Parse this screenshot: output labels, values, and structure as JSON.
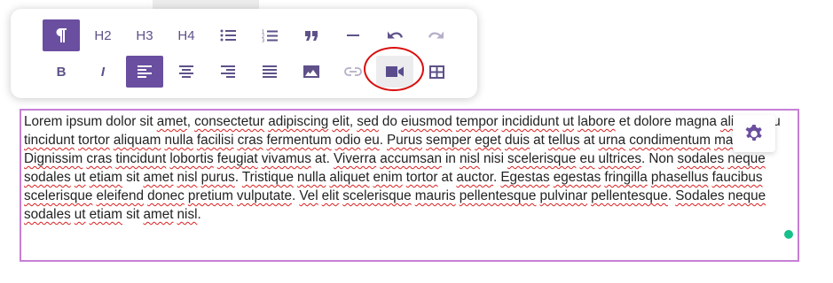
{
  "toolbar": {
    "row1": [
      {
        "name": "paragraph-button",
        "icon": "paragraph-icon",
        "active": true
      },
      {
        "name": "heading2-button",
        "label": "H2"
      },
      {
        "name": "heading3-button",
        "label": "H3"
      },
      {
        "name": "heading4-button",
        "label": "H4"
      },
      {
        "name": "bullet-list-button",
        "icon": "bullet-list-icon"
      },
      {
        "name": "ordered-list-button",
        "icon": "ordered-list-icon"
      },
      {
        "name": "quote-button",
        "icon": "quote-icon"
      },
      {
        "name": "horizontal-rule-button",
        "icon": "horizontal-rule-icon"
      },
      {
        "name": "undo-button",
        "icon": "undo-icon"
      },
      {
        "name": "redo-button",
        "icon": "redo-icon",
        "disabled": true
      }
    ],
    "row2": [
      {
        "name": "bold-button",
        "label": "B"
      },
      {
        "name": "italic-button",
        "label": "I"
      },
      {
        "name": "align-left-button",
        "icon": "align-left-icon",
        "active": true
      },
      {
        "name": "align-center-button",
        "icon": "align-center-icon"
      },
      {
        "name": "align-right-button",
        "icon": "align-right-icon"
      },
      {
        "name": "align-justify-button",
        "icon": "align-justify-icon"
      },
      {
        "name": "image-button",
        "icon": "image-icon"
      },
      {
        "name": "link-button",
        "icon": "link-icon",
        "disabled": true
      },
      {
        "name": "video-button",
        "icon": "video-icon",
        "highlighted": true
      },
      {
        "name": "table-button",
        "icon": "table-icon"
      }
    ]
  },
  "editor": {
    "paragraph": "Lorem ipsum dolor sit amet, consectetur adipiscing elit, sed do eiusmod tempor incididunt ut labore et dolore magna aliqua. Eu tincidunt tortor aliquam nulla facilisi cras fermentum odio eu. Purus semper eget duis at tellus at urna condimentum mattis. Dignissim cras tincidunt lobortis feugiat vivamus at. Viverra accumsan in nisl nisi scelerisque eu ultrices. Non sodales neque sodales ut etiam sit amet nisl purus. Tristique nulla aliquet enim tortor at auctor. Egestas egestas fringilla phasellus faucibus scelerisque eleifend donec pretium vulputate. Vel elit scelerisque mauris pellentesque pulvinar pellentesque. Sodales neque sodales ut etiam sit amet nisl.",
    "misspelled": [
      "amet",
      "consectetur",
      "adipiscing",
      "elit",
      "sed",
      "eiusmod",
      "tempor",
      "incididunt",
      "labore",
      "aliqua",
      "tincidunt",
      "tortor",
      "aliquam",
      "nulla",
      "facilisi",
      "cras",
      "fermentum",
      "odio",
      "eu",
      "Purus",
      "semper",
      "eget",
      "duis",
      "tellus",
      "urna",
      "condimentum",
      "mattis",
      "Dignissim",
      "lobortis",
      "feugiat",
      "vivamus",
      "Viverra",
      "accumsan",
      "nisl",
      "ultrices",
      "sodales",
      "neque",
      "ut",
      "etiam",
      "purus",
      "Tristique",
      "aliquet",
      "enim",
      "auctor",
      "Egestas",
      "egestas",
      "fringilla",
      "phasellus",
      "faucibus",
      "scelerisque",
      "eleifend",
      "donec",
      "pretium",
      "vulputate",
      "Vel",
      "mauris",
      "pellentesque",
      "pulvinar",
      "Sodales"
    ]
  },
  "colors": {
    "accent": "#6a4fa0",
    "icon": "#5f5189",
    "editor_border": "#c77fd6",
    "annotation": "#d90f0f",
    "status_dot": "#17bf8a",
    "spellcheck": "#d92020"
  },
  "settings_button": {
    "icon": "gear-icon"
  },
  "status": {
    "icon": "status-dot"
  }
}
